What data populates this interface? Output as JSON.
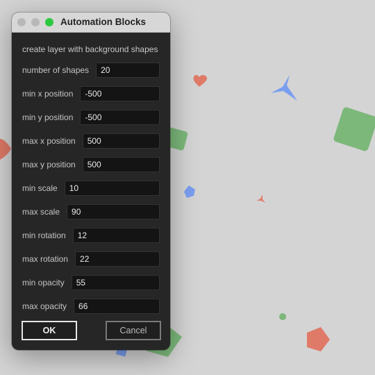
{
  "window": {
    "title": "Automation Blocks",
    "heading": "create layer with background shapes"
  },
  "fields": [
    {
      "label": "number of shapes",
      "value": "20"
    },
    {
      "label": "min x position",
      "value": "-500"
    },
    {
      "label": "min y position",
      "value": "-500"
    },
    {
      "label": "max x position",
      "value": "500"
    },
    {
      "label": "max y position",
      "value": "500"
    },
    {
      "label": "min scale",
      "value": "10"
    },
    {
      "label": "max scale",
      "value": "90"
    },
    {
      "label": "min rotation",
      "value": "12"
    },
    {
      "label": "max rotation",
      "value": "22"
    },
    {
      "label": "min opacity",
      "value": "55"
    },
    {
      "label": "max opacity",
      "value": "66"
    }
  ],
  "buttons": {
    "ok_label": "OK",
    "cancel_label": "Cancel"
  },
  "colors": {
    "red": "#e07a68",
    "blue": "#7a9ef0",
    "green": "#7cb87a",
    "close": "#b8b8b8",
    "maximize": "#2bc840"
  }
}
